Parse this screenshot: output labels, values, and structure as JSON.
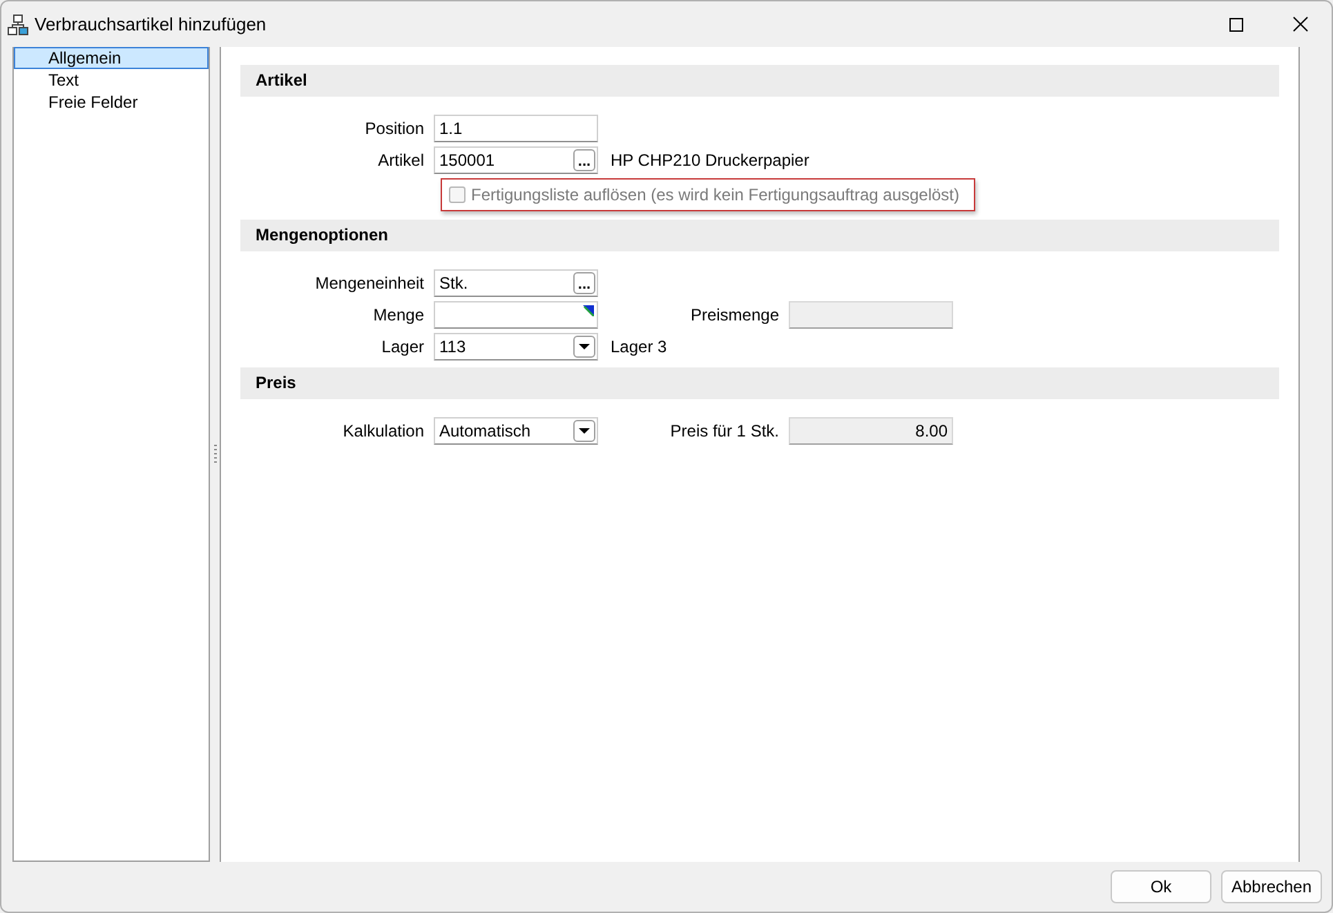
{
  "window": {
    "title": "Verbrauchsartikel hinzufügen"
  },
  "sidebar": {
    "items": [
      {
        "label": "Allgemein",
        "selected": true
      },
      {
        "label": "Text",
        "selected": false
      },
      {
        "label": "Freie Felder",
        "selected": false
      }
    ]
  },
  "sections": [
    {
      "title": "Artikel",
      "rows": [
        {
          "kind": "text",
          "label": "Position",
          "value": "1.1"
        },
        {
          "kind": "lookup",
          "label": "Artikel",
          "value": "150001",
          "button": "...",
          "note": "HP CHP210 Druckerpapier"
        },
        {
          "kind": "checkbox",
          "label": "Fertigungsliste auflösen (es wird kein Fertigungsauftrag ausgelöst)",
          "checked": false,
          "disabled": true
        }
      ]
    },
    {
      "title": "Mengenoptionen",
      "rows": [
        {
          "kind": "lookup",
          "label": "Mengeneinheit",
          "value": "Stk.",
          "button": "..."
        },
        {
          "kind": "indicator",
          "label": "Menge",
          "right": {
            "label": "Preismenge"
          }
        },
        {
          "kind": "combo",
          "label": "Lager",
          "value": "113",
          "note": "Lager 3"
        }
      ]
    },
    {
      "title": "Preis",
      "rows": [
        {
          "kind": "combo",
          "label": "Kalkulation",
          "value": "Automatisch",
          "right": {
            "label": "Preis für 1 Stk.",
            "value": "8.00"
          }
        }
      ]
    }
  ],
  "buttons": [
    {
      "label": "Ok"
    },
    {
      "label": "Abbrechen"
    }
  ]
}
